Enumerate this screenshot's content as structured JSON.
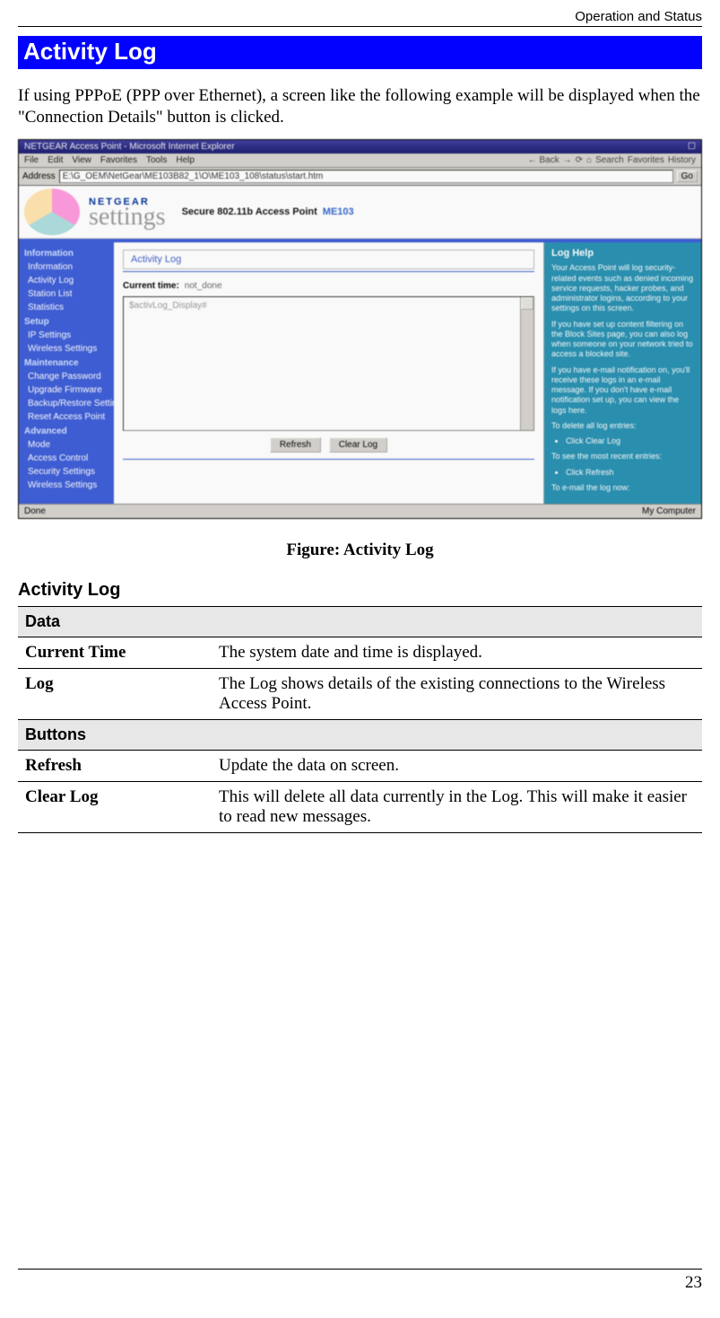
{
  "header": {
    "runningTitle": "Operation and Status"
  },
  "title": "Activity Log",
  "intro": "If using PPPoE (PPP over Ethernet), a screen like the following example will be displayed when the \"Connection Details\" button is clicked.",
  "caption": "Figure: Activity Log",
  "section2Heading": "Activity Log",
  "screenshot": {
    "windowTitle": "NETGEAR Access Point - Microsoft Internet Explorer",
    "menu": [
      "File",
      "Edit",
      "View",
      "Favorites",
      "Tools",
      "Help"
    ],
    "toolbar": [
      "← Back",
      "→",
      "⟳",
      "⌂",
      "Search",
      "Favorites",
      "History"
    ],
    "addressLabel": "Address",
    "addressValue": "E:\\G_OEM\\NetGear\\ME103B82_1\\O\\ME103_108\\status\\start.htm",
    "goLabel": "Go",
    "brand": "NETGEAR",
    "brandSub": "settings",
    "productLine": "Secure 802.11b Access Point",
    "model": "ME103",
    "sidebar": [
      {
        "type": "hdr",
        "label": "Information"
      },
      {
        "type": "item",
        "label": "Information"
      },
      {
        "type": "item",
        "label": "Activity Log"
      },
      {
        "type": "item",
        "label": "Station List"
      },
      {
        "type": "item",
        "label": "Statistics"
      },
      {
        "type": "hdr",
        "label": "Setup"
      },
      {
        "type": "item",
        "label": "IP Settings"
      },
      {
        "type": "item",
        "label": "Wireless Settings"
      },
      {
        "type": "hdr",
        "label": "Maintenance"
      },
      {
        "type": "item",
        "label": "Change Password"
      },
      {
        "type": "item",
        "label": "Upgrade Firmware"
      },
      {
        "type": "item",
        "label": "Backup/Restore Settings"
      },
      {
        "type": "item",
        "label": "Reset Access Point"
      },
      {
        "type": "hdr",
        "label": "Advanced"
      },
      {
        "type": "item",
        "label": "Mode"
      },
      {
        "type": "item",
        "label": "Access Control"
      },
      {
        "type": "item",
        "label": "Security Settings"
      },
      {
        "type": "item",
        "label": "Wireless Settings"
      }
    ],
    "centerTab": "Activity Log",
    "currentTimeLabel": "Current time:",
    "currentTimeValue": "not_done",
    "logText": "$activLog_Display#",
    "buttons": {
      "refresh": "Refresh",
      "clear": "Clear Log"
    },
    "help": {
      "title": "Log Help",
      "p1": "Your Access Point will log security-related events such as denied incoming service requests, hacker probes, and administrator logins, according to your settings on this screen.",
      "p2": "If you have set up content filtering on the Block Sites page, you can also log when someone on your network tried to access a blocked site.",
      "p3": "If you have e-mail notification on, you'll receive these logs in an e-mail message. If you don't have e-mail notification set up, you can view the logs here.",
      "p4": "To delete all log entries:",
      "b1": "Click Clear Log",
      "p5": "To see the most recent entries:",
      "b2": "Click Refresh",
      "p6": "To e-mail the log now:"
    },
    "statusLeft": "Done",
    "statusRight": "My Computer"
  },
  "table": {
    "sectionData": "Data",
    "sectionButtons": "Buttons",
    "rows": {
      "currentTimeKey": "Current Time",
      "currentTimeVal": "The system date and time is displayed.",
      "logKey": "Log",
      "logVal": "The Log shows details of the existing connections to the Wireless Access Point.",
      "refreshKey": "Refresh",
      "refreshVal": "Update the data on screen.",
      "clearKey": "Clear Log",
      "clearVal": "This will delete all data currently in the Log. This will make it easier to read new messages."
    }
  },
  "pageNumber": "23"
}
